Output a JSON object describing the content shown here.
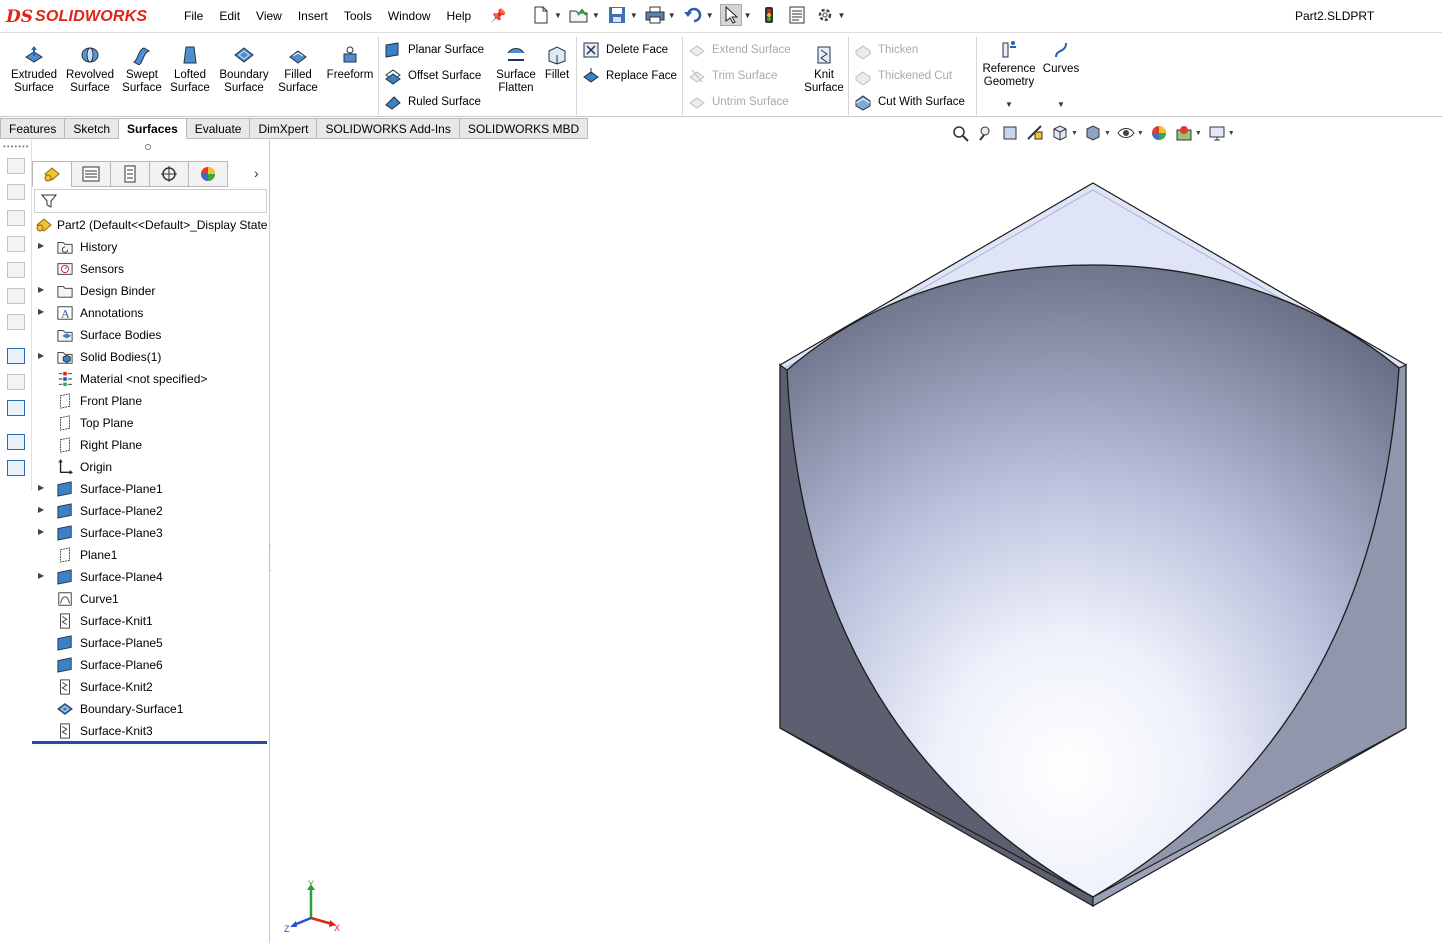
{
  "app": {
    "brand_prefix": "DS",
    "brand_name": "SOLIDWORKS",
    "document_title": "Part2.SLDPRT"
  },
  "menu": [
    "File",
    "Edit",
    "View",
    "Insert",
    "Tools",
    "Window",
    "Help"
  ],
  "quick_access": [
    "new-document",
    "open",
    "save",
    "print",
    "undo",
    "select",
    "rebuild",
    "file-properties",
    "options"
  ],
  "ribbon": {
    "extruded": "Extruded\nSurface",
    "revolved": "Revolved\nSurface",
    "swept": "Swept\nSurface",
    "lofted": "Lofted\nSurface",
    "boundary": "Boundary\nSurface",
    "filled": "Filled\nSurface",
    "freeform": "Freeform",
    "planar": "Planar Surface",
    "offset": "Offset Surface",
    "ruled": "Ruled Surface",
    "flatten": "Surface\nFlatten",
    "fillet": "Fillet",
    "delete_face": "Delete Face",
    "replace_face": "Replace Face",
    "extend": "Extend Surface",
    "trim": "Trim Surface",
    "untrim": "Untrim Surface",
    "knit": "Knit\nSurface",
    "thicken": "Thicken",
    "thickened_cut": "Thickened Cut",
    "cut_with_surface": "Cut With Surface",
    "reference_geometry": "Reference\nGeometry",
    "curves": "Curves"
  },
  "tabs": [
    {
      "label": "Features",
      "active": false
    },
    {
      "label": "Sketch",
      "active": false
    },
    {
      "label": "Surfaces",
      "active": true
    },
    {
      "label": "Evaluate",
      "active": false
    },
    {
      "label": "DimXpert",
      "active": false
    },
    {
      "label": "SOLIDWORKS Add-Ins",
      "active": false
    },
    {
      "label": "SOLIDWORKS MBD",
      "active": false
    }
  ],
  "feature_tree": {
    "root": "Part2  (Default<<Default>_Display State",
    "items": [
      {
        "label": "History",
        "icon": "folder-history-icon",
        "expandable": true
      },
      {
        "label": "Sensors",
        "icon": "sensor-icon",
        "expandable": false
      },
      {
        "label": "Design Binder",
        "icon": "design-binder-icon",
        "expandable": true
      },
      {
        "label": "Annotations",
        "icon": "annotations-icon",
        "expandable": true
      },
      {
        "label": "Surface Bodies",
        "icon": "surface-bodies-icon",
        "expandable": false
      },
      {
        "label": "Solid Bodies(1)",
        "icon": "solid-bodies-icon",
        "expandable": true
      },
      {
        "label": "Material <not specified>",
        "icon": "material-icon",
        "expandable": false
      },
      {
        "label": "Front Plane",
        "icon": "plane-icon",
        "expandable": false
      },
      {
        "label": "Top Plane",
        "icon": "plane-icon",
        "expandable": false
      },
      {
        "label": "Right Plane",
        "icon": "plane-icon",
        "expandable": false
      },
      {
        "label": "Origin",
        "icon": "origin-icon",
        "expandable": false
      },
      {
        "label": "Surface-Plane1",
        "icon": "surface-plane-icon",
        "expandable": true
      },
      {
        "label": "Surface-Plane2",
        "icon": "surface-plane-icon",
        "expandable": true
      },
      {
        "label": "Surface-Plane3",
        "icon": "surface-plane-icon",
        "expandable": true
      },
      {
        "label": "Plane1",
        "icon": "plane-icon",
        "expandable": false
      },
      {
        "label": "Surface-Plane4",
        "icon": "surface-plane-icon",
        "expandable": true
      },
      {
        "label": "Curve1",
        "icon": "curve-icon",
        "expandable": false
      },
      {
        "label": "Surface-Knit1",
        "icon": "surface-knit-icon",
        "expandable": false
      },
      {
        "label": "Surface-Plane5",
        "icon": "surface-plane-icon",
        "expandable": false
      },
      {
        "label": "Surface-Plane6",
        "icon": "surface-plane-icon",
        "expandable": false
      },
      {
        "label": "Surface-Knit2",
        "icon": "surface-knit-icon",
        "expandable": false
      },
      {
        "label": "Boundary-Surface1",
        "icon": "boundary-surface-icon",
        "expandable": false
      },
      {
        "label": "Surface-Knit3",
        "icon": "surface-knit-icon",
        "expandable": false
      }
    ]
  },
  "triad": {
    "x": "X",
    "y": "Y",
    "z": "Z"
  },
  "colors": {
    "brand_red": "#e2231a",
    "face_light": "#dde2f4",
    "side_dark": "#5b5f70",
    "rollback_bar": "#1f4fa3"
  }
}
